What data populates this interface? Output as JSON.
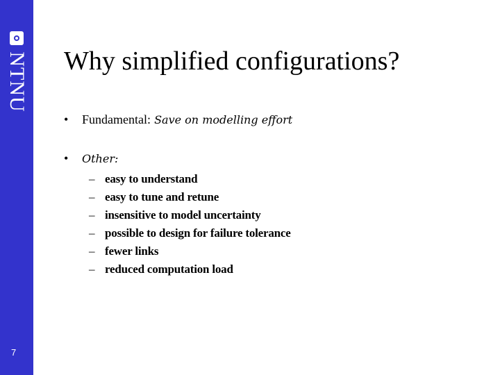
{
  "sidebar": {
    "logo_text": "NTNU",
    "page_number": "7",
    "color": "#3333cc"
  },
  "slide": {
    "title": "Why simplified configurations?",
    "bullets": [
      {
        "marker": "•",
        "label": "Fundamental:",
        "text": " Save on modelling effort"
      },
      {
        "marker": "•",
        "label": "",
        "text": "Other:"
      }
    ],
    "subitems": [
      {
        "marker": "–",
        "text": "easy to understand"
      },
      {
        "marker": "–",
        "text": "easy to tune and retune"
      },
      {
        "marker": "–",
        "text": "insensitive to model uncertainty"
      },
      {
        "marker": "–",
        "text": "possible to design for failure tolerance"
      },
      {
        "marker": "–",
        "text": "fewer links"
      },
      {
        "marker": "–",
        "text": "reduced computation load"
      }
    ]
  }
}
